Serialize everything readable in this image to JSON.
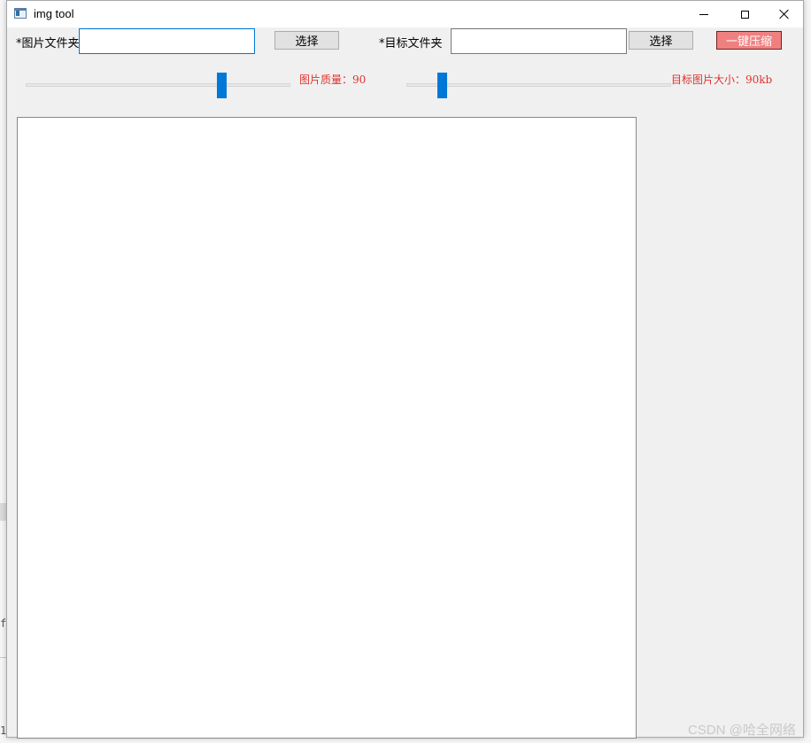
{
  "window": {
    "title": "img tool",
    "controls": {
      "minimize": "minimize",
      "maximize": "maximize",
      "close": "close"
    }
  },
  "form": {
    "source_label": "*图片文件夹",
    "source_value": "",
    "source_button": "选择",
    "target_label": "*目标文件夹",
    "target_value": "",
    "target_button": "选择",
    "compress_button": "一键压缩"
  },
  "sliders": {
    "quality_label": "图片质量：90",
    "quality_value": 90,
    "size_label": "目标图片大小：90kb",
    "size_value_kb": 90
  },
  "background": {
    "left_text_1": "fi",
    "left_text_2": "1"
  },
  "watermark": "CSDN @哈全网络",
  "colors": {
    "accent": "#0078d7",
    "compress_button_bg": "#f08080",
    "label_red": "#e0332e"
  }
}
